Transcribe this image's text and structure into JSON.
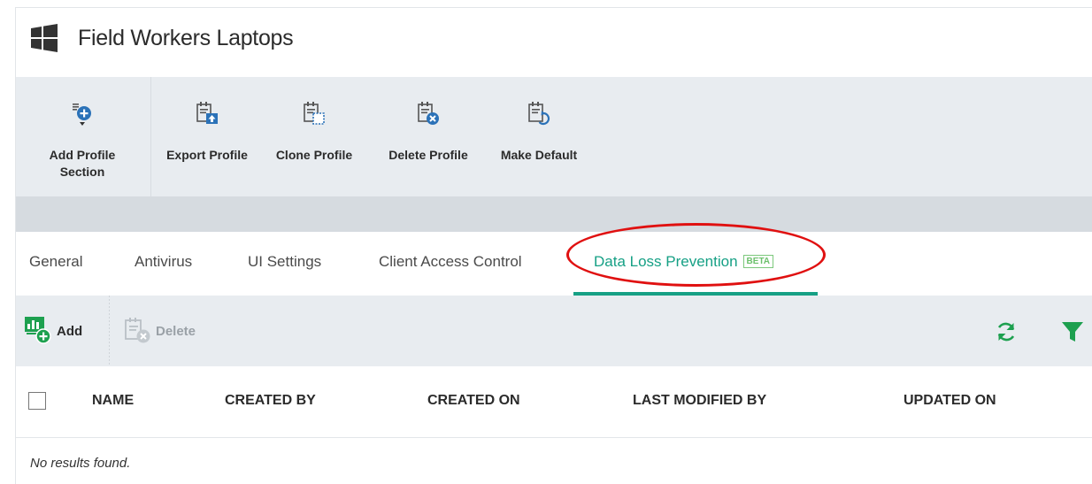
{
  "header": {
    "title": "Field Workers Laptops",
    "logo_icon": "windows-logo-icon"
  },
  "toolbar": {
    "buttons": [
      {
        "label": "Add Profile\nSection",
        "icon": "add-section-icon",
        "has_dropdown": true
      },
      {
        "label": "Export Profile",
        "icon": "export-profile-icon"
      },
      {
        "label": "Clone Profile",
        "icon": "clone-profile-icon"
      },
      {
        "label": "Delete Profile",
        "icon": "delete-profile-icon"
      },
      {
        "label": "Make Default",
        "icon": "make-default-icon"
      }
    ]
  },
  "tabs": {
    "items": [
      {
        "label": "General"
      },
      {
        "label": "Antivirus"
      },
      {
        "label": "UI Settings"
      },
      {
        "label": "Client Access Control"
      },
      {
        "label": "Data Loss Prevention",
        "badge": "BETA",
        "active": true
      }
    ]
  },
  "actions": {
    "add_label": "Add",
    "delete_label": "Delete",
    "delete_disabled": true,
    "refresh_icon": "refresh-icon",
    "filter_icon": "filter-icon"
  },
  "table": {
    "columns": [
      "NAME",
      "CREATED BY",
      "CREATED ON",
      "LAST MODIFIED BY",
      "UPDATED ON"
    ],
    "rows": [],
    "empty_message": "No results found."
  },
  "colors": {
    "accent": "#16a085",
    "icon_blue": "#2b72b8",
    "icon_green": "#1da04f",
    "highlight": "#e01010",
    "toolbar_bg": "#e8ecf0"
  }
}
